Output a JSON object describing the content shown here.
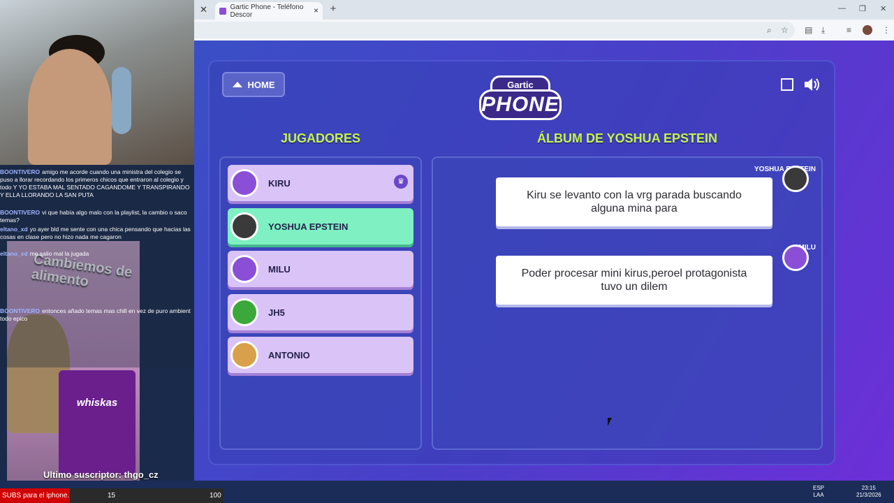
{
  "browser": {
    "tab_title": "Gartic Phone - Teléfono Descor",
    "tab_close": "×",
    "new_tab": "+"
  },
  "game": {
    "home_label": "HOME",
    "logo_top": "Gartic",
    "logo_main": "PHONE",
    "players_heading": "JUGADORES",
    "album_heading": "ÁLBUM DE YOSHUA EPSTEIN",
    "players": [
      {
        "name": "KIRU",
        "host": true,
        "color": "#8a4fd6"
      },
      {
        "name": "YOSHUA EPSTEIN",
        "active": true,
        "color": "#3a3a3a"
      },
      {
        "name": "MILU",
        "color": "#8a4fd6"
      },
      {
        "name": "JH5",
        "color": "#3aa83a"
      },
      {
        "name": "ANTONIO",
        "color": "#d8a04a"
      }
    ],
    "messages": [
      {
        "author": "YOSHUA EPSTEIN",
        "text": "Kiru se levanto con la vrg parada buscando alguna mina para"
      },
      {
        "author": "MILU",
        "text": "Poder procesar mini kirus,peroel protagonista tuvo un dilem"
      }
    ]
  },
  "stream": {
    "chat": [
      {
        "user": "BOONTIVERO",
        "text": "amigo me acorde cuando una ministra del colegio se puso a llorar recordando los primeros chicos que entraron al colegio y todo Y YO ESTABA MAL SENTADO CAGANDOME Y TRANSPIRANDO Y ELLA LLORANDO LA SAN PUTA"
      },
      {
        "user": "BOONTIVERO",
        "text": "vi que había algo malo con la playlist, la cambio o saco temas?"
      },
      {
        "user": "eltano_xd",
        "text": "yo ayer bld me sente con una chica pensando que hacias las cosas en clase pero no hizo nada me cagaron"
      },
      {
        "user": "eltano_xd",
        "text": "me salio mal la jugada"
      },
      {
        "user": "BOONTIVERO",
        "text": "entonces añado temas mas chill en vez de puro ambient todo epico"
      }
    ],
    "cat_ad_text": "Cambiemos de alimento",
    "pouch_label": "whiskas",
    "last_sub": "Ultimo suscriptor: thgo_cz",
    "ticker_text": "SUBS para el iphone.",
    "ticker_count": "15",
    "ticker_goal": "100"
  },
  "taskbar": {
    "lang_top": "ESP",
    "lang_bottom": "LAA",
    "time": "23:15",
    "date": "21/3/2026"
  }
}
